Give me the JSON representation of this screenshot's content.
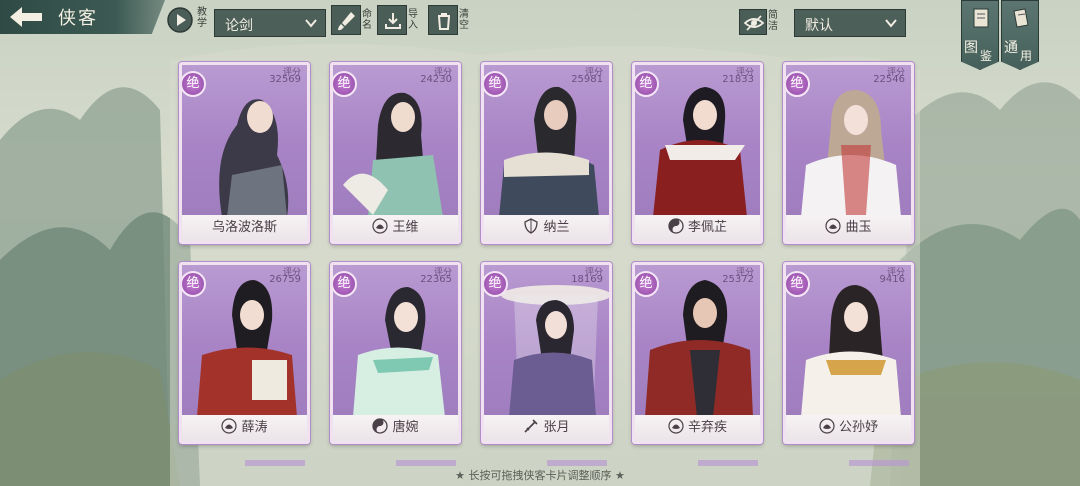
{
  "header": {
    "title": "侠客",
    "teach_label": "教学",
    "team_select": "论剑",
    "rename_label": "命名",
    "import_label": "导入",
    "clear_label": "清空",
    "filter_label": "简洁",
    "sort_select": "默认"
  },
  "right_tabs": [
    {
      "label1": "图",
      "label2": "鉴"
    },
    {
      "label1": "通",
      "label2": "用"
    }
  ],
  "card_common": {
    "rank": "绝",
    "score_label": "评分"
  },
  "cards": [
    {
      "name": "乌洛波洛斯",
      "score": "32569",
      "badge": "none"
    },
    {
      "name": "王维",
      "score": "24230",
      "badge": "lotus"
    },
    {
      "name": "纳兰",
      "score": "25981",
      "badge": "shield"
    },
    {
      "name": "李佩芷",
      "score": "21833",
      "badge": "yinyang"
    },
    {
      "name": "曲玉",
      "score": "22546",
      "badge": "lotus"
    },
    {
      "name": "薛涛",
      "score": "26759",
      "badge": "lotus"
    },
    {
      "name": "唐婉",
      "score": "22365",
      "badge": "yinyang"
    },
    {
      "name": "张月",
      "score": "18169",
      "badge": "sword"
    },
    {
      "name": "辛弃疾",
      "score": "25372",
      "badge": "lotus"
    },
    {
      "name": "公孙妤",
      "score": "9416",
      "badge": "lotus"
    }
  ],
  "footer": {
    "hint": "★ 长按可拖拽侠客卡片调整顺序 ★"
  },
  "colors": {
    "card_purple": "#a884c6",
    "bar_teal": "#4d5f59"
  }
}
